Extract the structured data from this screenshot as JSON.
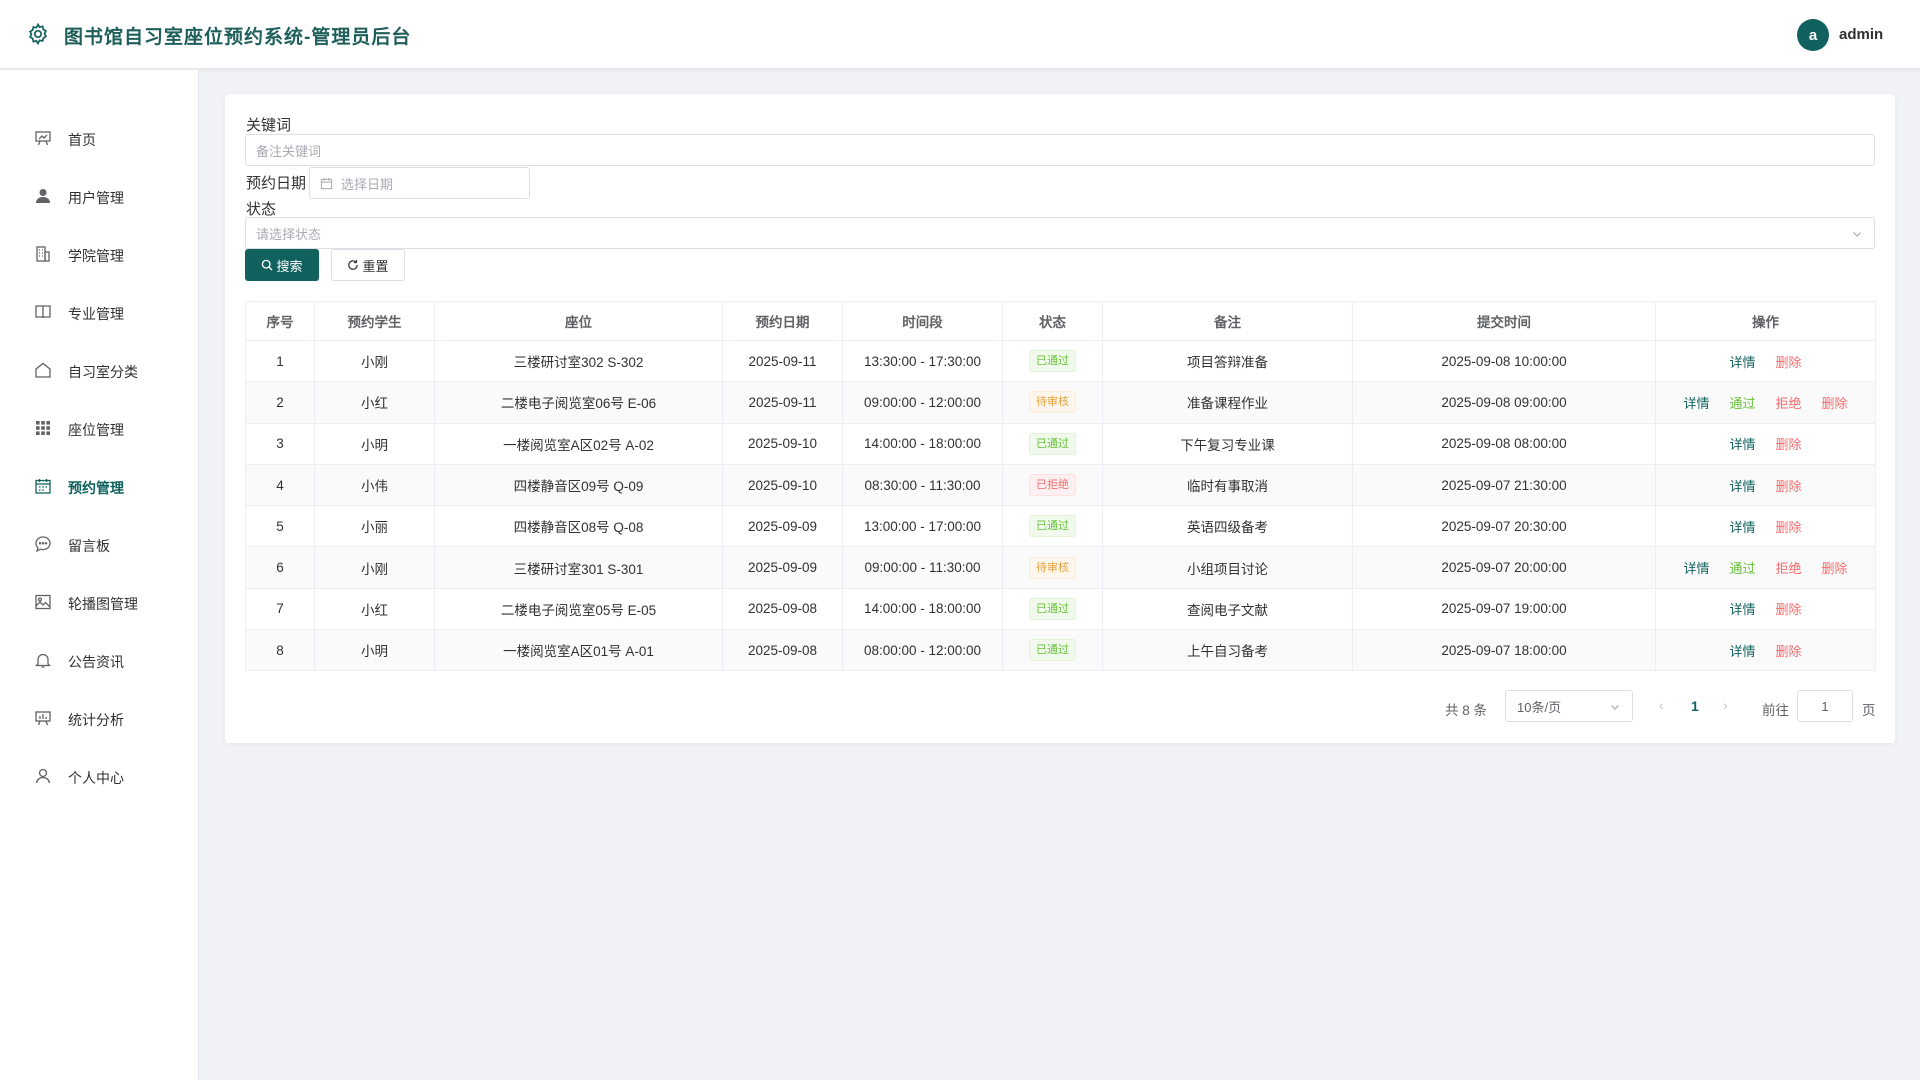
{
  "header": {
    "title": "图书馆自习室座位预约系统-管理员后台",
    "avatar_letter": "a",
    "username": "admin"
  },
  "sidebar": {
    "items": [
      {
        "label": "首页",
        "icon": "chart-icon"
      },
      {
        "label": "用户管理",
        "icon": "user-icon"
      },
      {
        "label": "学院管理",
        "icon": "building-icon"
      },
      {
        "label": "专业管理",
        "icon": "book-icon"
      },
      {
        "label": "自习室分类",
        "icon": "home-icon"
      },
      {
        "label": "座位管理",
        "icon": "grid-icon"
      },
      {
        "label": "预约管理",
        "icon": "calendar-icon",
        "active": true
      },
      {
        "label": "留言板",
        "icon": "chat-icon"
      },
      {
        "label": "轮播图管理",
        "icon": "image-icon"
      },
      {
        "label": "公告资讯",
        "icon": "bell-icon"
      },
      {
        "label": "统计分析",
        "icon": "stats-icon"
      },
      {
        "label": "个人中心",
        "icon": "person-icon"
      }
    ]
  },
  "filters": {
    "keyword_label": "关键词",
    "keyword_placeholder": "备注关键词",
    "date_label": "预约日期",
    "date_placeholder": "选择日期",
    "status_label": "状态",
    "status_placeholder": "请选择状态",
    "search_button": "搜索",
    "reset_button": "重置"
  },
  "table": {
    "columns": [
      "序号",
      "预约学生",
      "座位",
      "预约日期",
      "时间段",
      "状态",
      "备注",
      "提交时间",
      "操作"
    ],
    "rows": [
      {
        "no": "1",
        "student": "小刚",
        "seat": "三楼研讨室302 S-302",
        "date": "2025-09-11",
        "time": "13:30:00 - 17:30:00",
        "status": "已通过",
        "status_type": "ok",
        "note": "项目答辩准备",
        "submitted": "2025-09-08 10:00:00",
        "actions": [
          "详情",
          "删除"
        ]
      },
      {
        "no": "2",
        "student": "小红",
        "seat": "二楼电子阅览室06号 E-06",
        "date": "2025-09-11",
        "time": "09:00:00 - 12:00:00",
        "status": "待审核",
        "status_type": "wait",
        "note": "准备课程作业",
        "submitted": "2025-09-08 09:00:00",
        "actions": [
          "详情",
          "通过",
          "拒绝",
          "删除"
        ]
      },
      {
        "no": "3",
        "student": "小明",
        "seat": "一楼阅览室A区02号 A-02",
        "date": "2025-09-10",
        "time": "14:00:00 - 18:00:00",
        "status": "已通过",
        "status_type": "ok",
        "note": "下午复习专业课",
        "submitted": "2025-09-08 08:00:00",
        "actions": [
          "详情",
          "删除"
        ]
      },
      {
        "no": "4",
        "student": "小伟",
        "seat": "四楼静音区09号 Q-09",
        "date": "2025-09-10",
        "time": "08:30:00 - 11:30:00",
        "status": "已拒绝",
        "status_type": "rej",
        "note": "临时有事取消",
        "submitted": "2025-09-07 21:30:00",
        "actions": [
          "详情",
          "删除"
        ]
      },
      {
        "no": "5",
        "student": "小丽",
        "seat": "四楼静音区08号 Q-08",
        "date": "2025-09-09",
        "time": "13:00:00 - 17:00:00",
        "status": "已通过",
        "status_type": "ok",
        "note": "英语四级备考",
        "submitted": "2025-09-07 20:30:00",
        "actions": [
          "详情",
          "删除"
        ]
      },
      {
        "no": "6",
        "student": "小刚",
        "seat": "三楼研讨室301 S-301",
        "date": "2025-09-09",
        "time": "09:00:00 - 11:30:00",
        "status": "待审核",
        "status_type": "wait",
        "note": "小组项目讨论",
        "submitted": "2025-09-07 20:00:00",
        "actions": [
          "详情",
          "通过",
          "拒绝",
          "删除"
        ]
      },
      {
        "no": "7",
        "student": "小红",
        "seat": "二楼电子阅览室05号 E-05",
        "date": "2025-09-08",
        "time": "14:00:00 - 18:00:00",
        "status": "已通过",
        "status_type": "ok",
        "note": "查阅电子文献",
        "submitted": "2025-09-07 19:00:00",
        "actions": [
          "详情",
          "删除"
        ]
      },
      {
        "no": "8",
        "student": "小明",
        "seat": "一楼阅览室A区01号 A-01",
        "date": "2025-09-08",
        "time": "08:00:00 - 12:00:00",
        "status": "已通过",
        "status_type": "ok",
        "note": "上午自习备考",
        "submitted": "2025-09-07 18:00:00",
        "actions": [
          "详情",
          "删除"
        ]
      }
    ]
  },
  "pagination": {
    "total": "共 8 条",
    "page_size": "10条/页",
    "current_page": "1",
    "goto_label": "前往",
    "goto_value": "1",
    "page_suffix": "页"
  },
  "colors": {
    "brand": "#11625e",
    "success": "#67c23a",
    "warning": "#e6a23c",
    "danger": "#f56c6c"
  }
}
